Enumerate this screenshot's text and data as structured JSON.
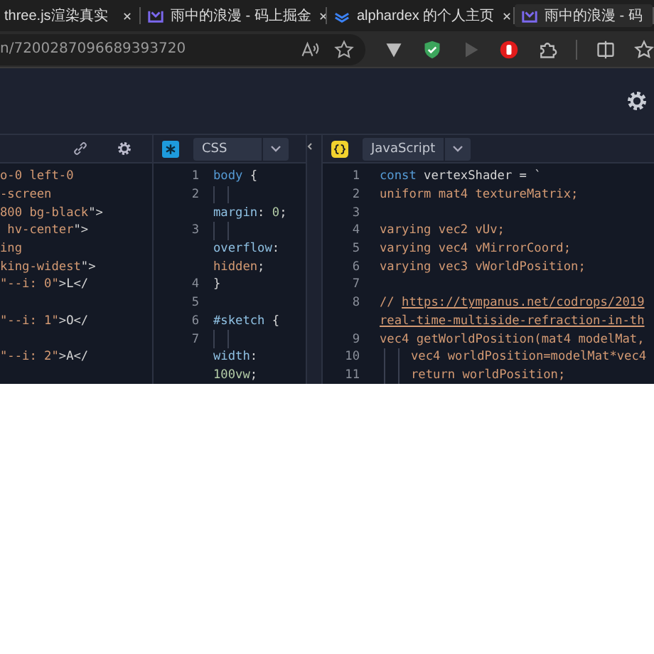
{
  "browser": {
    "tabs": [
      {
        "title": "three.js渲染真实",
        "selected": false
      },
      {
        "title": "雨中的浪漫 - 码上掘金",
        "selected": false
      },
      {
        "title": "alphardex 的个人主页",
        "selected": false
      },
      {
        "title": "雨中的浪漫 - 码",
        "selected": true
      }
    ],
    "address": "n/7200287096689393720"
  },
  "editors": {
    "html": {
      "lines": [
        {
          "kind": "wrap",
          "tokens": [
            {
              "text": "o-0 left-0",
              "kind": "str"
            }
          ]
        },
        {
          "kind": "wrap",
          "tokens": [
            {
              "text": "-screen",
              "kind": "str"
            }
          ]
        },
        {
          "kind": "wrap",
          "tokens": [
            {
              "text": "800 bg-black",
              "kind": "str"
            },
            {
              "text": "\">",
              "kind": "plain"
            }
          ]
        },
        {
          "kind": "wrap",
          "tokens": [
            {
              "text": " hv-center",
              "kind": "str"
            },
            {
              "text": "\">",
              "kind": "plain"
            }
          ]
        },
        {
          "kind": "wrap",
          "tokens": [
            {
              "text": "ing",
              "kind": "str"
            }
          ]
        },
        {
          "kind": "wrap",
          "tokens": [
            {
              "text": "king-widest",
              "kind": "str"
            },
            {
              "text": "\">",
              "kind": "plain"
            }
          ]
        },
        {
          "kind": "wrap",
          "tokens": [
            {
              "text": "\"--i: 0\"",
              "kind": "str"
            },
            {
              "text": ">L</",
              "kind": "plain"
            }
          ]
        },
        {
          "kind": "blank"
        },
        {
          "kind": "wrap",
          "tokens": [
            {
              "text": "\"--i: 1\"",
              "kind": "str"
            },
            {
              "text": ">O</",
              "kind": "plain"
            }
          ]
        },
        {
          "kind": "blank"
        },
        {
          "kind": "wrap",
          "tokens": [
            {
              "text": "\"--i: 2\"",
              "kind": "str"
            },
            {
              "text": ">A</",
              "kind": "plain"
            }
          ]
        }
      ]
    },
    "css": {
      "language": "CSS",
      "lines": [
        {
          "kind": "line",
          "number": "1",
          "tokens": [
            {
              "text": "body",
              "kind": "kw"
            },
            {
              "text": " {",
              "kind": "plain"
            }
          ]
        },
        {
          "kind": "line",
          "number": "2",
          "indented": true
        },
        {
          "kind": "wrap",
          "tokens": [
            {
              "text": "margin",
              "kind": "prop"
            },
            {
              "text": ": ",
              "kind": "plain"
            },
            {
              "text": "0",
              "kind": "num"
            },
            {
              "text": ";",
              "kind": "plain"
            }
          ]
        },
        {
          "kind": "line",
          "number": "3",
          "indented": true
        },
        {
          "kind": "wrap",
          "tokens": [
            {
              "text": "overflow",
              "kind": "prop"
            },
            {
              "text": ":",
              "kind": "plain"
            }
          ]
        },
        {
          "kind": "wrap",
          "tokens": [
            {
              "text": "hidden",
              "kind": "str"
            },
            {
              "text": ";",
              "kind": "plain"
            }
          ]
        },
        {
          "kind": "line",
          "number": "4",
          "tokens": [
            {
              "text": "}",
              "kind": "plain"
            }
          ]
        },
        {
          "kind": "line",
          "number": "5"
        },
        {
          "kind": "line",
          "number": "6",
          "tokens": [
            {
              "text": "#sketch",
              "kind": "prop"
            },
            {
              "text": " {",
              "kind": "plain"
            }
          ]
        },
        {
          "kind": "line",
          "number": "7",
          "indented": true
        },
        {
          "kind": "wrap",
          "tokens": [
            {
              "text": "width",
              "kind": "prop"
            },
            {
              "text": ":",
              "kind": "plain"
            }
          ]
        },
        {
          "kind": "wrap",
          "tokens": [
            {
              "text": "100vw",
              "kind": "num"
            },
            {
              "text": ";",
              "kind": "plain"
            }
          ]
        }
      ]
    },
    "js": {
      "language": "JavaScript",
      "lines": [
        {
          "kind": "line",
          "number": "1",
          "tokens": [
            {
              "text": "const",
              "kind": "kw"
            },
            {
              "text": " vertexShader = `",
              "kind": "plain"
            }
          ]
        },
        {
          "kind": "line",
          "number": "2",
          "tokens": [
            {
              "text": "uniform mat4 textureMatrix;",
              "kind": "str"
            }
          ]
        },
        {
          "kind": "line",
          "number": "3"
        },
        {
          "kind": "line",
          "number": "4",
          "tokens": [
            {
              "text": "varying vec2 vUv;",
              "kind": "str"
            }
          ]
        },
        {
          "kind": "line",
          "number": "5",
          "tokens": [
            {
              "text": "varying vec4 vMirrorCoord;",
              "kind": "str"
            }
          ]
        },
        {
          "kind": "line",
          "number": "6",
          "tokens": [
            {
              "text": "varying vec3 vWorldPosition;",
              "kind": "str"
            }
          ]
        },
        {
          "kind": "line",
          "number": "7"
        },
        {
          "kind": "line",
          "number": "8",
          "tokens": [
            {
              "text": "// ",
              "kind": "str"
            },
            {
              "text": "https://tympanus.net/codrops/2019",
              "kind": "link"
            }
          ]
        },
        {
          "kind": "wrap",
          "tokens": [
            {
              "text": "real-time-multiside-refraction-in-th",
              "kind": "link"
            }
          ]
        },
        {
          "kind": "line",
          "number": "9",
          "tokens": [
            {
              "text": "vec4 getWorldPosition(mat4 modelMat,",
              "kind": "str"
            }
          ]
        },
        {
          "kind": "line",
          "number": "10",
          "indented": true,
          "tokens": [
            {
              "text": "vec4 worldPosition=modelMat*vec4",
              "kind": "str"
            }
          ]
        },
        {
          "kind": "line",
          "number": "11",
          "indented": true,
          "tokens": [
            {
              "text": "return worldPosition;",
              "kind": "str"
            }
          ]
        }
      ]
    }
  }
}
